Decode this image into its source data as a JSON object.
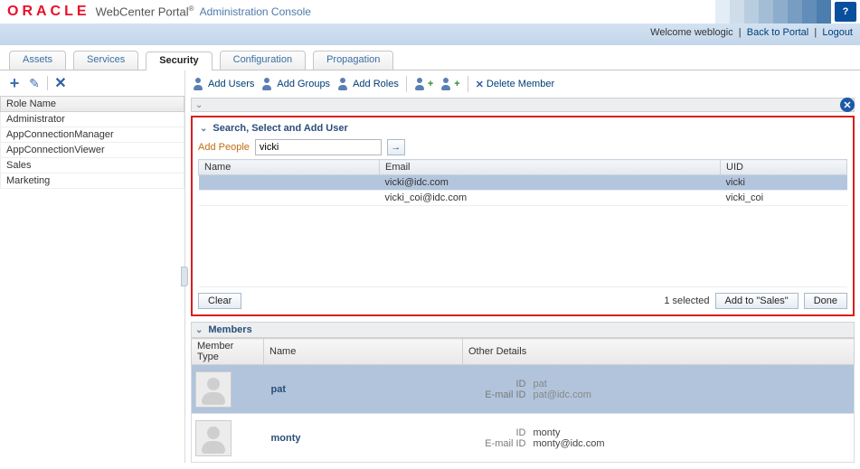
{
  "brand": {
    "logo": "ORACLE",
    "product": "WebCenter Portal",
    "console": "Administration Console"
  },
  "header": {
    "welcome": "Welcome weblogic",
    "back_to_portal": "Back to Portal",
    "logout": "Logout"
  },
  "tabs": [
    "Assets",
    "Services",
    "Security",
    "Configuration",
    "Propagation"
  ],
  "active_tab": "Security",
  "roles": {
    "header": "Role Name",
    "items": [
      "Administrator",
      "AppConnectionManager",
      "AppConnectionViewer",
      "Sales",
      "Marketing"
    ]
  },
  "toolbar": {
    "add_users": "Add Users",
    "add_groups": "Add Groups",
    "add_roles": "Add Roles",
    "delete_member": "Delete Member"
  },
  "search_panel": {
    "title": "Search, Select and Add User",
    "add_people_label": "Add People",
    "input_value": "vicki",
    "columns": {
      "name": "Name",
      "email": "Email",
      "uid": "UID"
    },
    "rows": [
      {
        "name": "",
        "email": "vicki@idc.com",
        "uid": "vicki",
        "selected": true
      },
      {
        "name": "",
        "email": "vicki_coi@idc.com",
        "uid": "vicki_coi",
        "selected": false
      }
    ],
    "clear": "Clear",
    "selected_text": "1 selected",
    "add_to": "Add to \"Sales\"",
    "done": "Done"
  },
  "members": {
    "title": "Members",
    "columns": {
      "type": "Member Type",
      "name": "Name",
      "other": "Other Details"
    },
    "rows": [
      {
        "name": "pat",
        "id_label": "ID",
        "id": "pat",
        "email_label": "E-mail ID",
        "email": "pat@idc.com",
        "selected": true
      },
      {
        "name": "monty",
        "id_label": "ID",
        "id": "monty",
        "email_label": "E-mail ID",
        "email": "monty@idc.com",
        "selected": false
      }
    ]
  }
}
